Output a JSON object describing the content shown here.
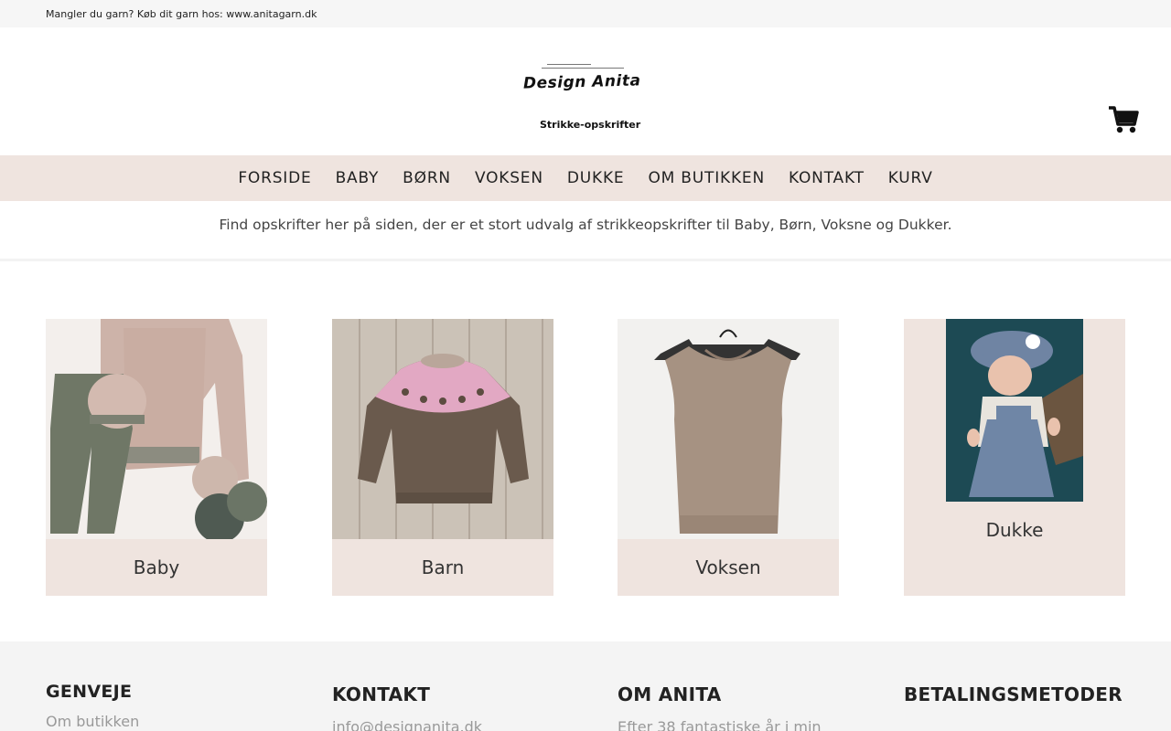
{
  "topbar": {
    "text": "Mangler du garn? Køb dit garn hos: www.anitagarn.dk"
  },
  "header": {
    "logo_brand": "Design Anita",
    "logo_tagline": "Strikke-opskrifter",
    "cart_icon": "shopping-cart-icon"
  },
  "nav": {
    "items": [
      "FORSIDE",
      "BABY",
      "BØRN",
      "VOKSEN",
      "DUKKE",
      "OM BUTIKKEN",
      "KONTAKT",
      "KURV"
    ]
  },
  "intro": {
    "text": "Find opskrifter her på siden, der er et stort udvalg af strikkeopskrifter til Baby, Børn, Voksne og Dukker."
  },
  "categories": [
    {
      "label": "Baby"
    },
    {
      "label": "Barn"
    },
    {
      "label": "Voksen"
    },
    {
      "label": "Dukke"
    }
  ],
  "footer": {
    "shortcuts": {
      "title": "GENVEJE",
      "first_link": "Om butikken"
    },
    "contact": {
      "title": "KONTAKT",
      "email": "info@designanita.dk"
    },
    "about": {
      "title": "OM ANITA",
      "text": "Efter 38 fantastiske år i min"
    },
    "payment": {
      "title": "BETALINGSMETODER"
    }
  },
  "colors": {
    "accent_band": "#efe4df",
    "topbar": "#f6f6f6",
    "footer": "#f4f4f4"
  }
}
